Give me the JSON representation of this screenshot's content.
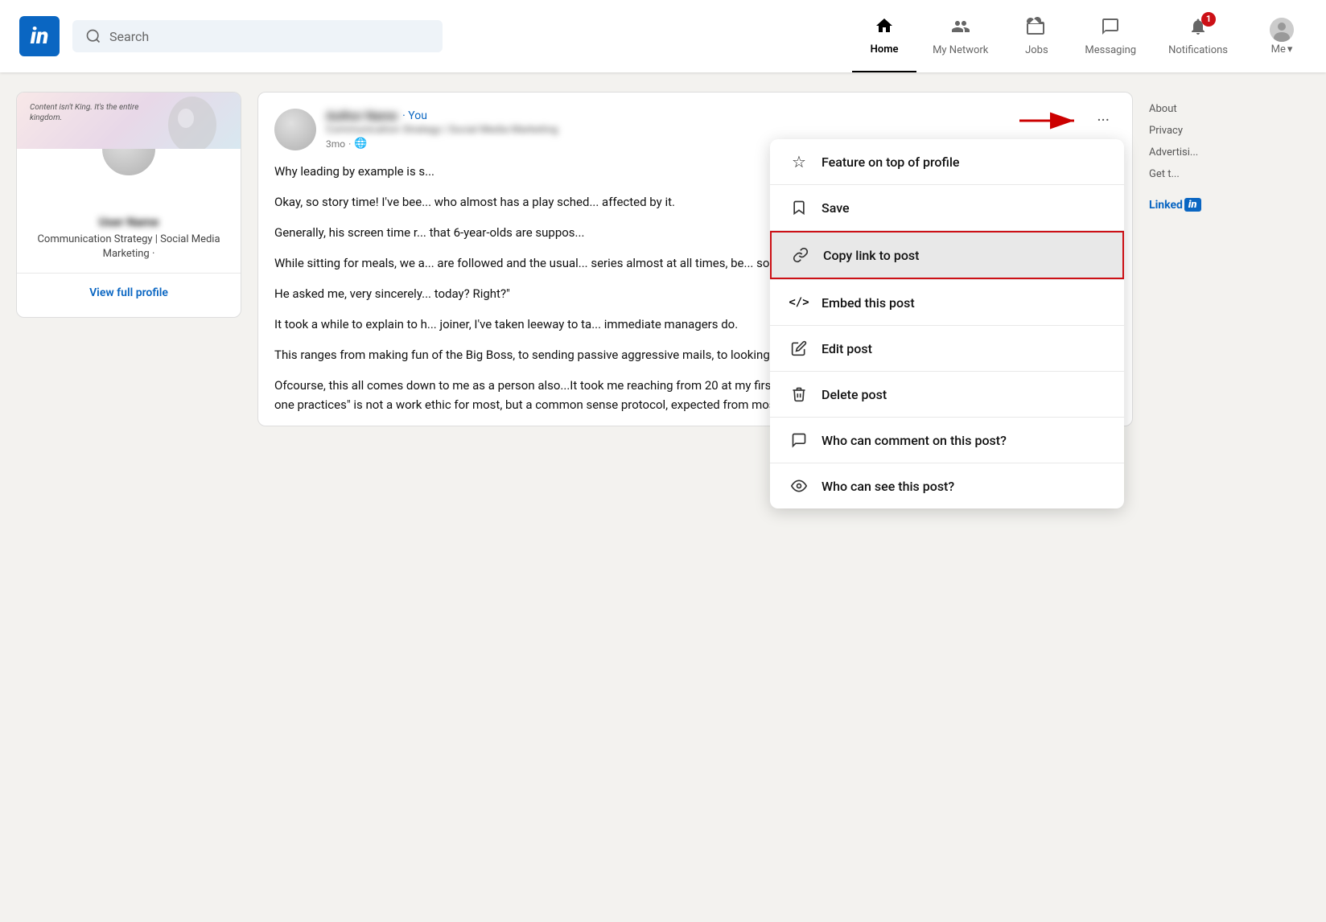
{
  "navbar": {
    "logo_text": "in",
    "search_placeholder": "Search",
    "nav_items": [
      {
        "id": "home",
        "label": "Home",
        "active": true,
        "badge": null
      },
      {
        "id": "my-network",
        "label": "My Network",
        "active": false,
        "badge": null
      },
      {
        "id": "jobs",
        "label": "Jobs",
        "active": false,
        "badge": null
      },
      {
        "id": "messaging",
        "label": "Messaging",
        "active": false,
        "badge": null
      },
      {
        "id": "notifications",
        "label": "Notifications",
        "active": false,
        "badge": "1"
      }
    ],
    "me_label": "Me"
  },
  "left_sidebar": {
    "profile_card": {
      "banner_text": "Content isn't King. It's the entire\nkingdom.",
      "name_blurred": "User Name",
      "title": "Communication Strategy | Social\nMedia Marketing ·",
      "view_profile_label": "View full profile"
    }
  },
  "post": {
    "author_name": "Author Name",
    "you_tag": "· You",
    "author_title": "Communication Strategy | Social Media Marketing",
    "post_time": "3mo",
    "visibility": "🌐",
    "paragraphs": [
      "Why leading by example is s...",
      "Okay, so story time! I've bee... who almost has a play sched... affected by it.",
      "Generally, his screen time r... that 6-year-olds are suppos...",
      "While sitting for meals, we a... are followed and the usual... series almost at all times, be... so much reading you can do...",
      "He asked me, very sincerely... today? Right?\"",
      "It took a while to explain to h... joiner, I've taken leeway to ta... immediate managers do.",
      "This ranges from making fun of the Big Boss, to sending passive aggressive mails, to looking down at a certain rival team..",
      "Ofcourse, this all comes down to me as a person also...It took me reaching from 20 at my first job to 22 at my second before I realised how, \"preaching what one practices\" is not a work ethic for most, but a common sense protocol, expected from most-especially new joiners!"
    ]
  },
  "dropdown_menu": {
    "items": [
      {
        "id": "feature-on-top",
        "icon": "☆",
        "label": "Feature on top of profile",
        "highlighted": false
      },
      {
        "id": "save",
        "icon": "🔖",
        "label": "Save",
        "highlighted": false
      },
      {
        "id": "copy-link",
        "icon": "🔗",
        "label": "Copy link to post",
        "highlighted": true
      },
      {
        "id": "embed-post",
        "icon": "</>",
        "label": "Embed this post",
        "highlighted": false
      },
      {
        "id": "edit-post",
        "icon": "✏️",
        "label": "Edit post",
        "highlighted": false
      },
      {
        "id": "delete-post",
        "icon": "🗑️",
        "label": "Delete post",
        "highlighted": false
      },
      {
        "id": "who-can-comment",
        "icon": "💬",
        "label": "Who can comment on this post?",
        "highlighted": false
      },
      {
        "id": "who-can-see",
        "icon": "👁",
        "label": "Who can see this post?",
        "highlighted": false
      }
    ]
  },
  "right_sidebar": {
    "links": [
      {
        "id": "about",
        "label": "About"
      },
      {
        "id": "privacy",
        "label": "Privacy"
      },
      {
        "id": "advertising",
        "label": "Advertisi..."
      },
      {
        "id": "get-t",
        "label": "Get t..."
      }
    ],
    "brand_text": "Linked",
    "brand_badge": "in"
  }
}
